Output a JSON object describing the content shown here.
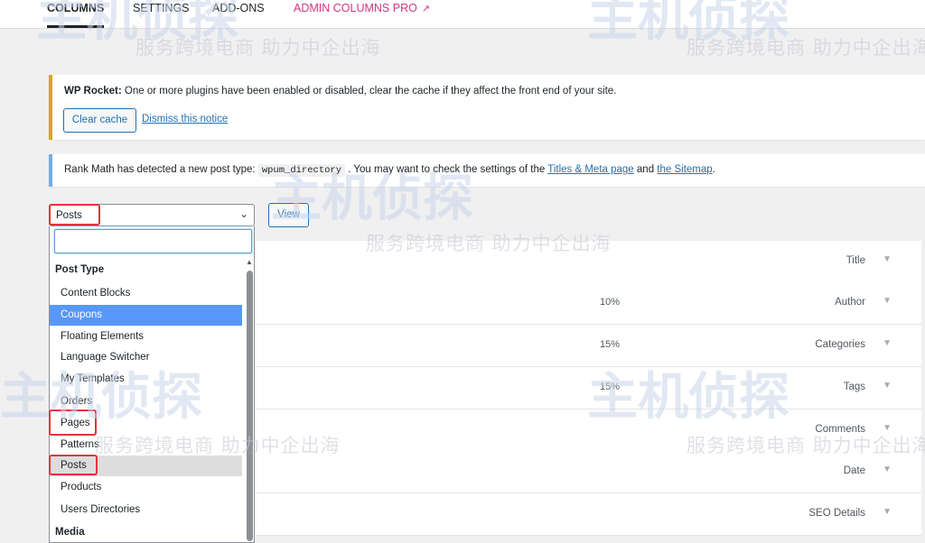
{
  "nav": {
    "tabs": [
      {
        "label": "COLUMNS",
        "active": true
      },
      {
        "label": "SETTINGS",
        "active": false
      },
      {
        "label": "ADD-ONS",
        "active": false
      },
      {
        "label": "ADMIN COLUMNS PRO",
        "active": false,
        "external": true
      }
    ]
  },
  "notices": {
    "wp_rocket": {
      "title": "WP Rocket:",
      "message": "One or more plugins have been enabled or disabled, clear the cache if they affect the front end of your site.",
      "clear_cache": "Clear cache",
      "dismiss": "Dismiss this notice"
    },
    "rank_math": {
      "prefix": "Rank Math has detected a new post type:",
      "code": "wpum_directory",
      "middle": ". You may want to check the settings of the",
      "link1": "Titles & Meta page",
      "and": "and",
      "link2": "the Sitemap",
      "suffix": "."
    }
  },
  "selector": {
    "value": "Posts",
    "view_button": "View",
    "search_placeholder": ""
  },
  "dropdown": {
    "group_post_type": "Post Type",
    "options": [
      "Content Blocks",
      "Coupons",
      "Floating Elements",
      "Language Switcher",
      "My Templates",
      "Orders",
      "Pages",
      "Patterns",
      "Posts",
      "Products",
      "Users Directories"
    ],
    "highlighted": "Coupons",
    "selected": "Posts",
    "group_media": "Media"
  },
  "columns": [
    {
      "label": "Title",
      "width": ""
    },
    {
      "label": "Author",
      "width": "10%"
    },
    {
      "label": "Categories",
      "width": "15%"
    },
    {
      "label": "Tags",
      "width": "15%"
    },
    {
      "label": "Comments",
      "width": ""
    },
    {
      "label": "Date",
      "width": ""
    },
    {
      "label": "SEO Details",
      "width": ""
    }
  ],
  "watermark": {
    "slogan": "服务跨境电商 助力中企出海",
    "logo": "主机侦探"
  },
  "colors": {
    "accent": "#2271b1",
    "pro": "#d63384",
    "highlight": "#5897fb",
    "annotation": "#e0353b"
  }
}
